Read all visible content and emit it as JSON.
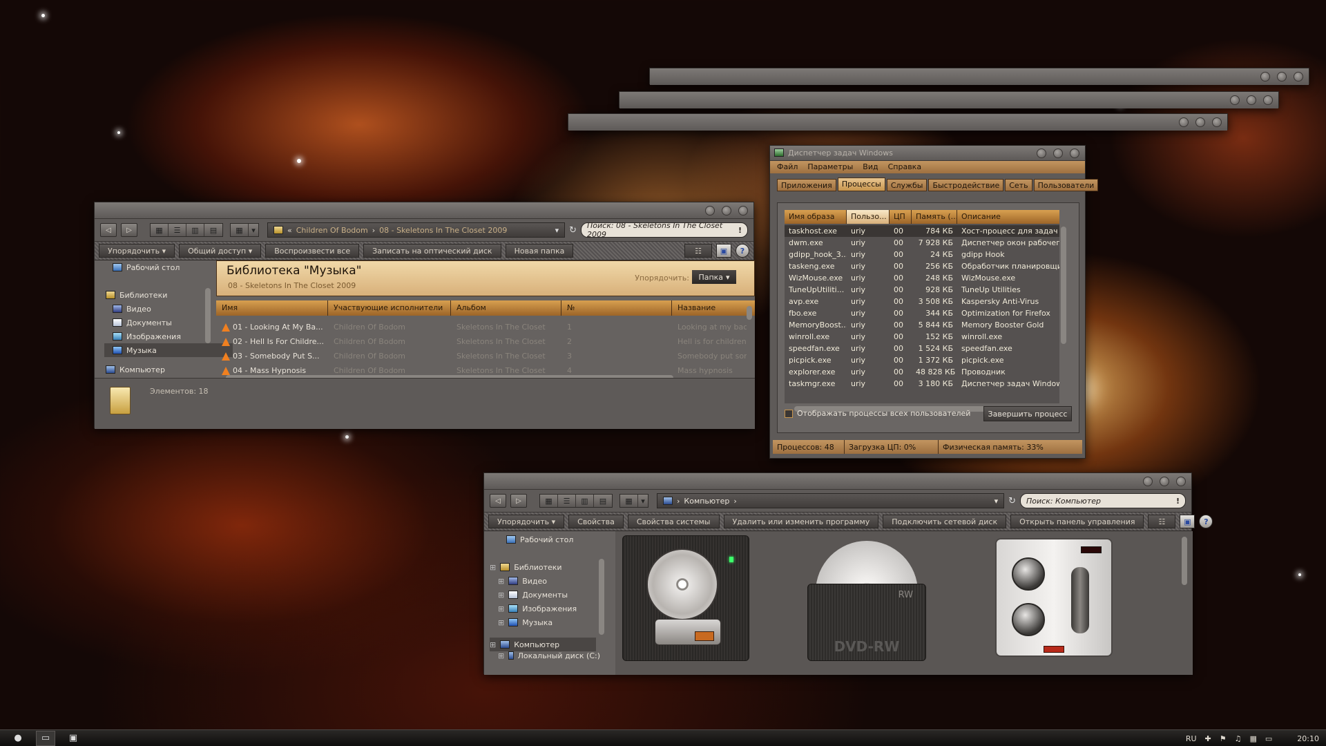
{
  "colors": {
    "accent": "#c8964e",
    "chrome": "#6c6866",
    "dark": "#2a2725"
  },
  "music_window": {
    "nav": {
      "back": "◁",
      "forward": "▷"
    },
    "breadcrumb": [
      "Children Of Bodom",
      "08 - Skeletons In The Closet 2009"
    ],
    "search_placeholder": "Поиск: 08 - Skeletons In The Closet 2009",
    "commands": [
      "Упорядочить",
      "Общий доступ",
      "Воспроизвести все",
      "Записать на оптический диск",
      "Новая папка"
    ],
    "tree": {
      "desktop": "Рабочий стол",
      "libraries": "Библиотеки",
      "video": "Видео",
      "documents": "Документы",
      "images": "Изображения",
      "music": "Музыка",
      "computer": "Компьютер"
    },
    "library_title": "Библиотека \"Музыка\"",
    "library_subtitle": "08 - Skeletons In The Closet 2009",
    "arrange_label": "Упорядочить:",
    "arrange_value": "Папка",
    "columns": [
      "Имя",
      "Участвующие исполнители",
      "Альбом",
      "№",
      "Название"
    ],
    "rows": [
      {
        "name": "01 - Looking At My Ba...",
        "artist": "Children Of Bodom",
        "album": "Skeletons In The Closet",
        "num": "1",
        "title": "Looking at my back d"
      },
      {
        "name": "02 - Hell Is For Childre...",
        "artist": "Children Of Bodom",
        "album": "Skeletons In The Closet",
        "num": "2",
        "title": "Hell is for children"
      },
      {
        "name": "03 - Somebody Put S...",
        "artist": "Children Of Bodom",
        "album": "Skeletons In The Closet",
        "num": "3",
        "title": "Somebody put some"
      },
      {
        "name": "04 - Mass Hypnosis",
        "artist": "Children Of Bodom",
        "album": "Skeletons In The Closet",
        "num": "4",
        "title": "Mass hypnosis"
      }
    ],
    "items_count": "Элементов: 18"
  },
  "task_manager": {
    "title": "Диспетчер задач Windows",
    "menu": [
      "Файл",
      "Параметры",
      "Вид",
      "Справка"
    ],
    "tabs": [
      "Приложения",
      "Процессы",
      "Службы",
      "Быстродействие",
      "Сеть",
      "Пользователи"
    ],
    "columns": [
      "Имя образа",
      "Пользо...",
      "ЦП",
      "Память (...",
      "Описание"
    ],
    "processes": [
      {
        "name": "taskhost.exe",
        "user": "uriy",
        "cpu": "00",
        "mem": "784 КБ",
        "desc": "Хост-процесс для задач W"
      },
      {
        "name": "dwm.exe",
        "user": "uriy",
        "cpu": "00",
        "mem": "7 928 КБ",
        "desc": "Диспетчер окон рабочего"
      },
      {
        "name": "gdipp_hook_3...",
        "user": "uriy",
        "cpu": "00",
        "mem": "24 КБ",
        "desc": "gdipp Hook"
      },
      {
        "name": "taskeng.exe",
        "user": "uriy",
        "cpu": "00",
        "mem": "256 КБ",
        "desc": "Обработчик планировщи"
      },
      {
        "name": "WizMouse.exe",
        "user": "uriy",
        "cpu": "00",
        "mem": "248 КБ",
        "desc": "WizMouse.exe"
      },
      {
        "name": "TuneUpUtiliti...",
        "user": "uriy",
        "cpu": "00",
        "mem": "928 КБ",
        "desc": "TuneUp Utilities"
      },
      {
        "name": "avp.exe",
        "user": "uriy",
        "cpu": "00",
        "mem": "3 508 КБ",
        "desc": "Kaspersky Anti-Virus"
      },
      {
        "name": "fbo.exe",
        "user": "uriy",
        "cpu": "00",
        "mem": "344 КБ",
        "desc": "Optimization for Firefox"
      },
      {
        "name": "MemoryBoost...",
        "user": "uriy",
        "cpu": "00",
        "mem": "5 844 КБ",
        "desc": "Memory Booster Gold"
      },
      {
        "name": "winroll.exe",
        "user": "uriy",
        "cpu": "00",
        "mem": "152 КБ",
        "desc": "winroll.exe"
      },
      {
        "name": "speedfan.exe",
        "user": "uriy",
        "cpu": "00",
        "mem": "1 524 КБ",
        "desc": "speedfan.exe"
      },
      {
        "name": "picpick.exe",
        "user": "uriy",
        "cpu": "00",
        "mem": "1 372 КБ",
        "desc": "picpick.exe"
      },
      {
        "name": "explorer.exe",
        "user": "uriy",
        "cpu": "00",
        "mem": "48 828 КБ",
        "desc": "Проводник"
      },
      {
        "name": "taskmgr.exe",
        "user": "uriy",
        "cpu": "00",
        "mem": "3 180 КБ",
        "desc": "Диспетчер задач Window"
      }
    ],
    "show_all_users": "Отображать процессы всех пользователей",
    "end_process": "Завершить процесс",
    "status": {
      "processes": "Процессов: 48",
      "cpu": "Загрузка ЦП: 0%",
      "memory": "Физическая память: 33%"
    }
  },
  "computer_window": {
    "breadcrumb": "Компьютер",
    "search_placeholder": "Поиск: Компьютер",
    "commands": [
      "Упорядочить",
      "Свойства",
      "Свойства системы",
      "Удалить или изменить программу",
      "Подключить сетевой диск",
      "Открыть панель управления"
    ],
    "tree": {
      "desktop": "Рабочий стол",
      "libraries": "Библиотеки",
      "video": "Видео",
      "documents": "Документы",
      "images": "Изображения",
      "music": "Музыка",
      "computer": "Компьютер",
      "local_disk": "Локальный диск (C:)"
    },
    "dvd_label": "DVD-RW",
    "dvd_small": "RW"
  },
  "taskbar": {
    "lang": "RU",
    "time": "20:10"
  }
}
